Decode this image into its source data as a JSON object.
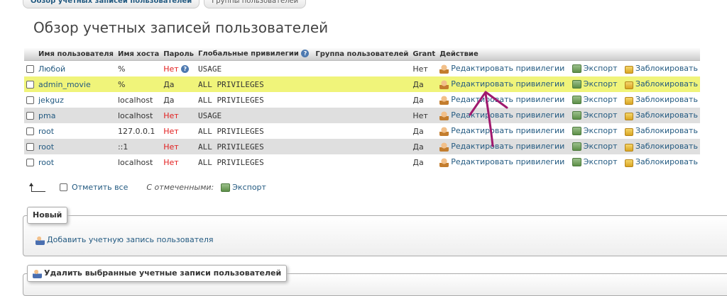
{
  "tabs": [
    "Обзор учетных записей пользователей",
    "Группы пользователей"
  ],
  "page_title": "Обзор учетных записей пользователей",
  "columns": [
    "",
    "Имя пользователя",
    "Имя хоста",
    "Пароль",
    "Глобальные привилегии",
    "Группа пользователей",
    "Grant",
    "Действие"
  ],
  "rows": [
    {
      "user": "Любой",
      "host": "%",
      "password": "Нет",
      "privileges": "USAGE",
      "group": "",
      "grant": "Нет"
    },
    {
      "user": "admin_movie",
      "host": "%",
      "password": "Да",
      "privileges": "ALL PRIVILEGES",
      "group": "",
      "grant": "Да"
    },
    {
      "user": "jekguz",
      "host": "localhost",
      "password": "Да",
      "privileges": "ALL PRIVILEGES",
      "group": "",
      "grant": "Да"
    },
    {
      "user": "pma",
      "host": "localhost",
      "password": "Нет",
      "privileges": "USAGE",
      "group": "",
      "grant": "Нет"
    },
    {
      "user": "root",
      "host": "127.0.0.1",
      "password": "Нет",
      "privileges": "ALL PRIVILEGES",
      "group": "",
      "grant": "Да"
    },
    {
      "user": "root",
      "host": "::1",
      "password": "Нет",
      "privileges": "ALL PRIVILEGES",
      "group": "",
      "grant": "Да"
    },
    {
      "user": "root",
      "host": "localhost",
      "password": "Нет",
      "privileges": "ALL PRIVILEGES",
      "group": "",
      "grant": "Да"
    }
  ],
  "actions": {
    "edit": "Редактировать привилегии",
    "export": "Экспорт",
    "lock": "Заблокировать"
  },
  "bulk": {
    "check_all": "Отметить все",
    "with_selected": "С отмеченными:",
    "export": "Экспорт"
  },
  "new_section": {
    "legend": "Новый",
    "add_user": "Добавить учетную запись пользователя"
  },
  "delete_section": {
    "legend": "Удалить выбранные учетные записи пользователей"
  },
  "colors": {
    "highlight": "#f0f47a",
    "annotation": "#a0196e",
    "link": "#235a81",
    "no_red": "#e21e1e"
  }
}
